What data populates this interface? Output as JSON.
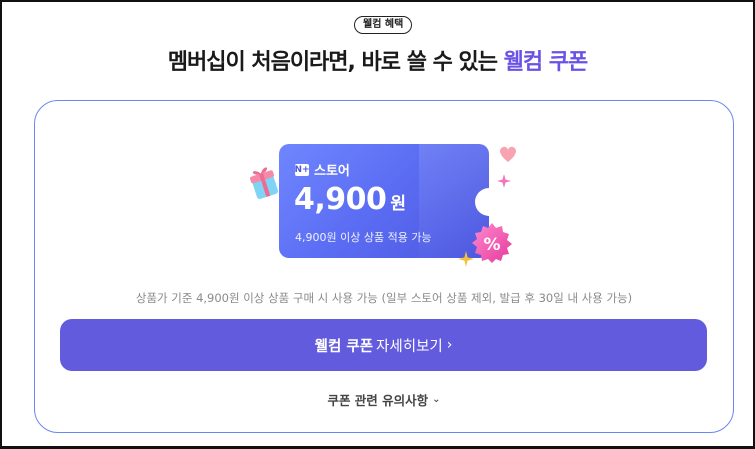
{
  "badge": "웰컴 혜택",
  "headline": {
    "main": "멤버십이 처음이라면, 바로 쓸 수 있는 ",
    "accent": "웰컴 쿠폰"
  },
  "coupon": {
    "logo_icon": "naver-plus-logo-icon",
    "logo_text": "N+",
    "store": "스토어",
    "amount": "4,900",
    "unit": "원",
    "condition": "4,900원 이상 상품 적용 가능",
    "decorations": [
      "gift-box-icon",
      "heart-icon",
      "sparkle-icon",
      "percent-badge-icon"
    ]
  },
  "notice": "상품가 기준 4,900원 이상 상품 구매 시 사용 가능 (일부 스토어 상품 제외, 발급 후 30일 내 사용 가능)",
  "cta": {
    "strong": "웰컴 쿠폰",
    "rest": "자세히보기",
    "chevron": "›"
  },
  "policy": {
    "label": "쿠폰 관련 유의사항",
    "chevron": "⌄"
  },
  "colors": {
    "accent": "#6a52e6",
    "cta_bg": "#635bdd",
    "card_border": "#6b86f0",
    "coupon_gradient_start": "#6f86ff",
    "coupon_gradient_end": "#4d57df"
  }
}
